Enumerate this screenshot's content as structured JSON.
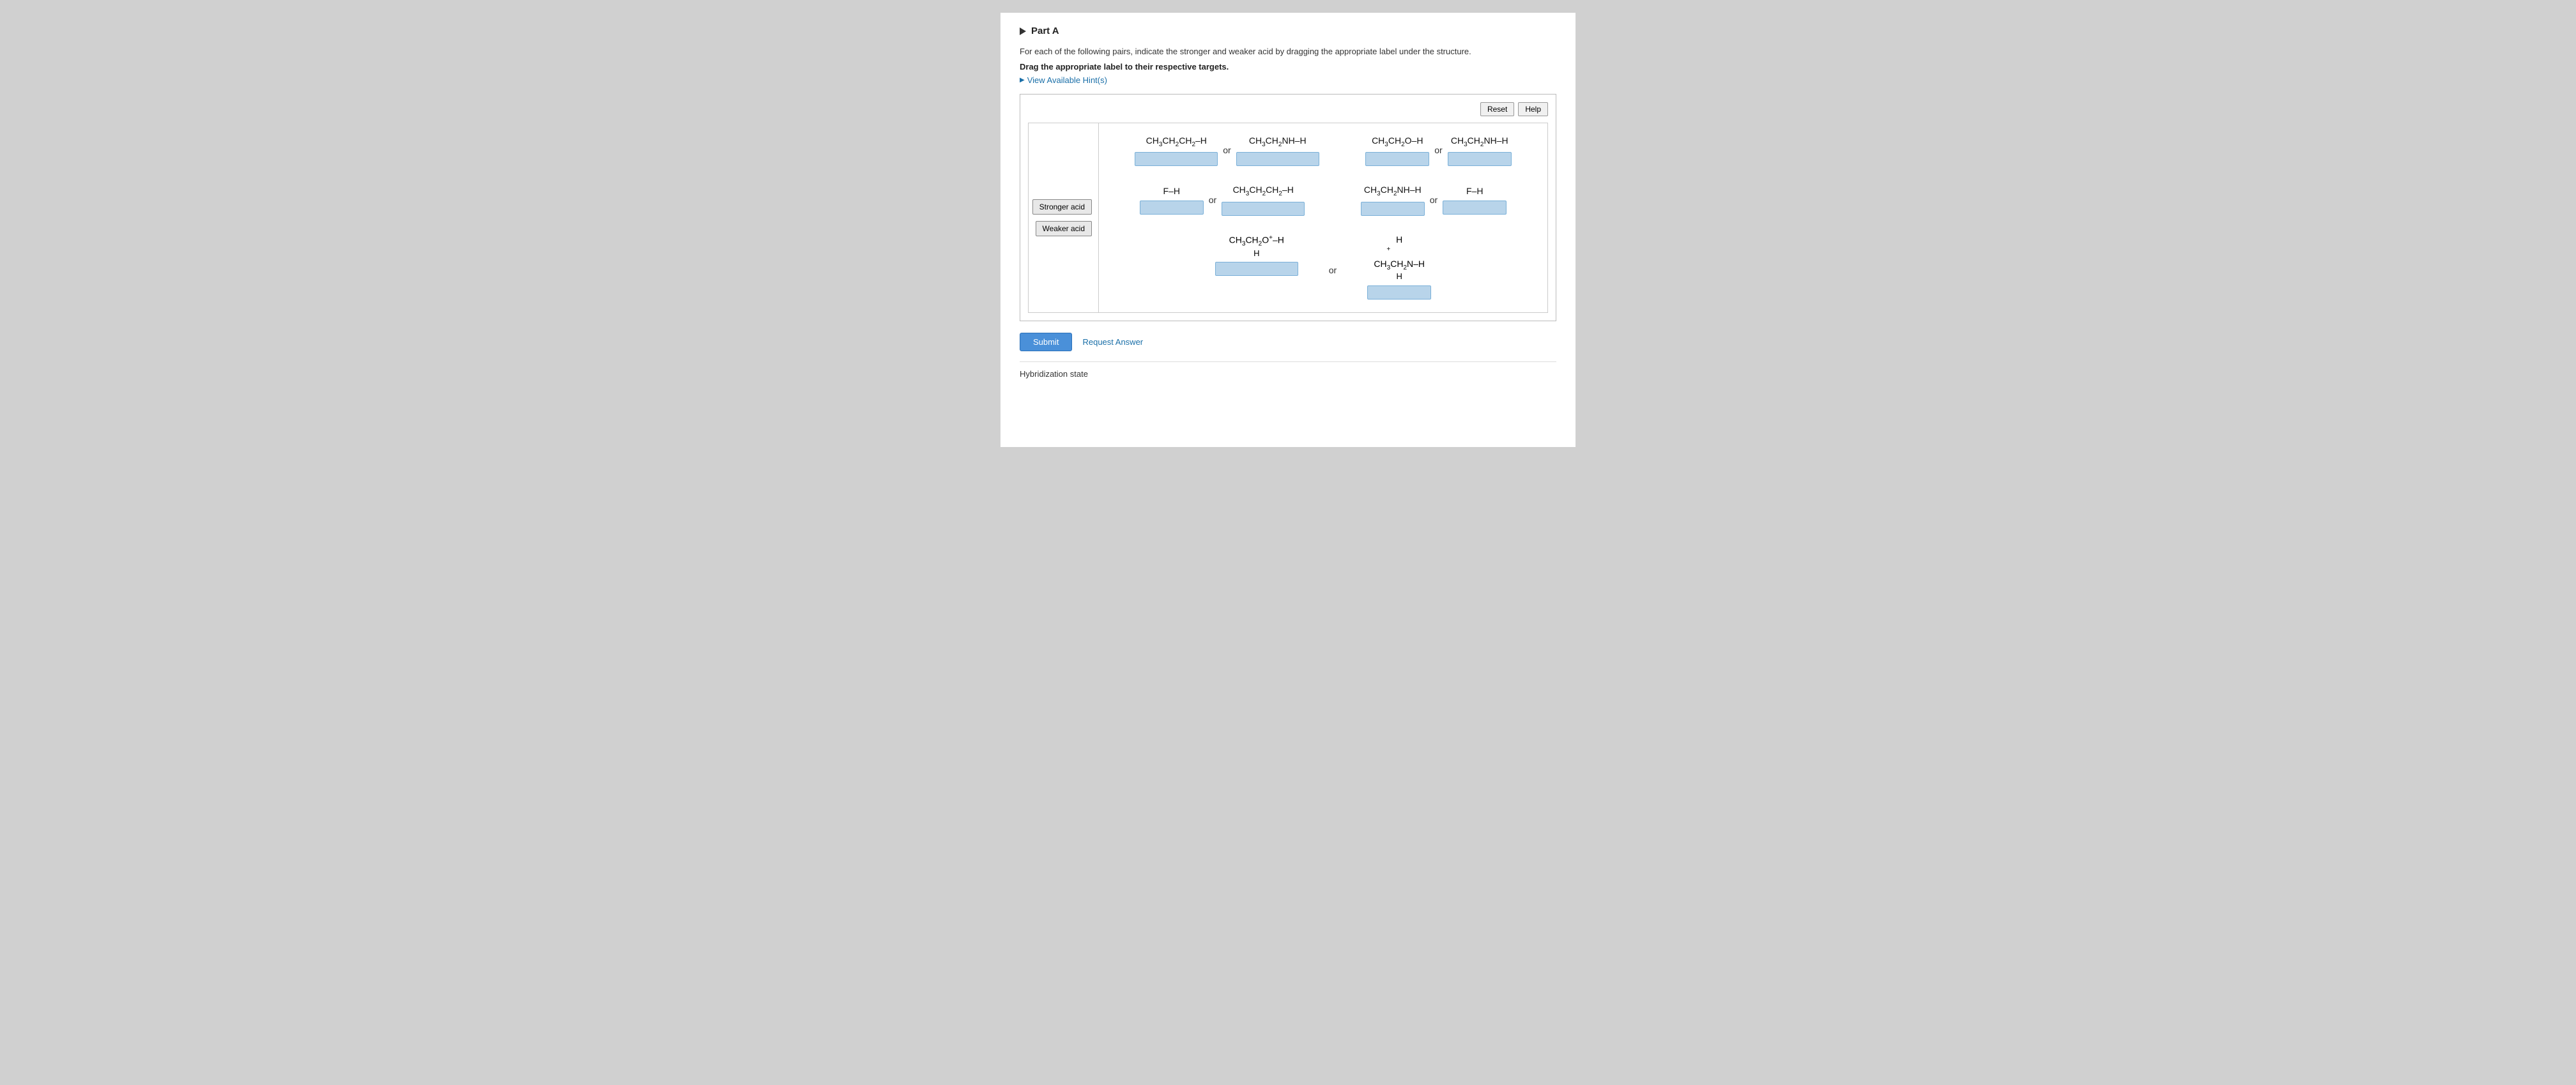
{
  "page": {
    "part_label": "Part A",
    "instructions": "For each of the following pairs, indicate the stronger and weaker acid by dragging the appropriate label under the structure.",
    "instructions_bold": "Drag the appropriate label to their respective targets.",
    "hint_text": "View Available Hint(s)",
    "buttons": {
      "reset": "Reset",
      "help": "Help",
      "submit": "Submit",
      "request_answer": "Request Answer"
    },
    "labels": {
      "stronger": "Stronger acid",
      "weaker": "Weaker acid"
    },
    "pair_connector_or": "or",
    "bottom_section_title": "Hybridization state",
    "formulas": {
      "row1_pair1_left": "CH₃CH₂CH₂–H",
      "row1_pair1_right": "CH₃CH₂NH–H",
      "row1_pair2_left": "CH₃CH₂O–H",
      "row1_pair2_right": "CH₃CH₂NH–H",
      "row2_pair1_left": "F–H",
      "row2_pair1_right": "CH₃CH₂CH₂–H",
      "row2_pair2_left": "CH₃CH₂NH–H",
      "row2_pair2_right": "F–H",
      "row3_left_top": "CH₃CH₂O⁺–H",
      "row3_left_mid": "H",
      "row3_right_top": "H",
      "row3_right_label": "⁺",
      "row3_right_mid": "CH₃CH₂N–H",
      "row3_right_bot": "H"
    }
  }
}
